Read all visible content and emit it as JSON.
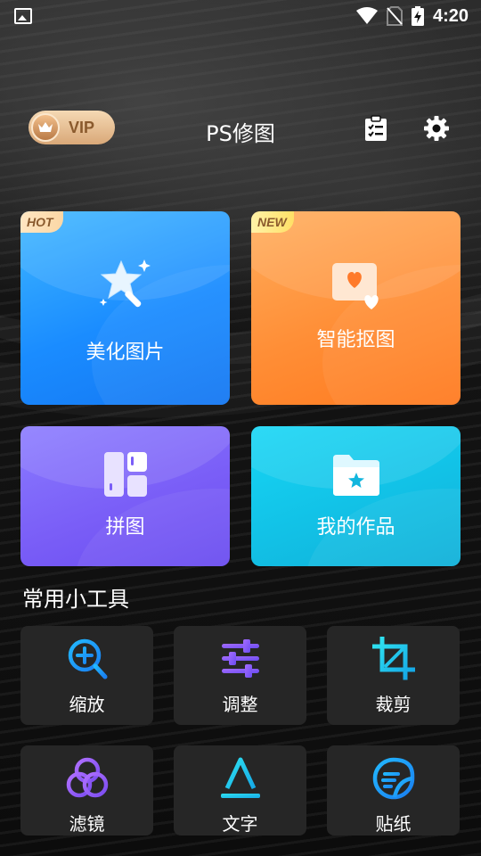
{
  "status_bar": {
    "time": "4:20"
  },
  "header": {
    "vip_label": "VIP",
    "title": "PS修图"
  },
  "cards": [
    {
      "label": "美化图片",
      "badge": "HOT"
    },
    {
      "label": "智能抠图",
      "badge": "NEW"
    },
    {
      "label": "拼图"
    },
    {
      "label": "我的作品"
    }
  ],
  "tools_section": {
    "title": "常用小工具",
    "items": [
      {
        "label": "缩放",
        "icon": "zoom-in-icon"
      },
      {
        "label": "调整",
        "icon": "sliders-icon"
      },
      {
        "label": "裁剪",
        "icon": "crop-icon"
      },
      {
        "label": "滤镜",
        "icon": "filter-circles-icon"
      },
      {
        "label": "文字",
        "icon": "text-a-icon"
      },
      {
        "label": "贴纸",
        "icon": "sticker-icon"
      }
    ]
  },
  "colors": {
    "vip_gold": "#d9a878",
    "card_blue": "#1e90ff",
    "card_orange": "#ff8a2a",
    "card_purple": "#7b5cf5",
    "card_cyan": "#19c4e6",
    "tool_bg": "#262626",
    "tool_icon_blue": "#1aa0f5",
    "tool_icon_purple": "#8a5cf6"
  }
}
